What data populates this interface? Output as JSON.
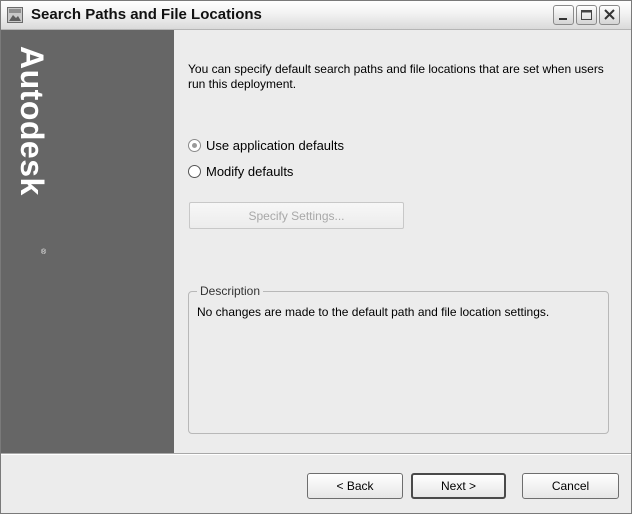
{
  "window": {
    "title": "Search Paths and File Locations"
  },
  "sidebar": {
    "brand": "Autodesk",
    "registered_mark": "®"
  },
  "content": {
    "intro": "You can specify default search paths and file locations that are set when users run this deployment.",
    "options": [
      {
        "label": "Use application defaults",
        "selected": true
      },
      {
        "label": "Modify defaults",
        "selected": false
      }
    ],
    "specify_button": {
      "label": "Specify Settings...",
      "enabled": false
    },
    "description": {
      "legend": "Description",
      "text": "No changes are made to the default path and file location settings."
    }
  },
  "footer": {
    "back_label": "< Back",
    "next_label": "Next >",
    "cancel_label": "Cancel"
  },
  "colors": {
    "sidebar_bg": "#666666",
    "panel_bg": "#ececec"
  },
  "icons": {
    "app": "app-icon",
    "minimize": "minimize-icon",
    "maximize": "maximize-icon",
    "close": "close-icon"
  }
}
